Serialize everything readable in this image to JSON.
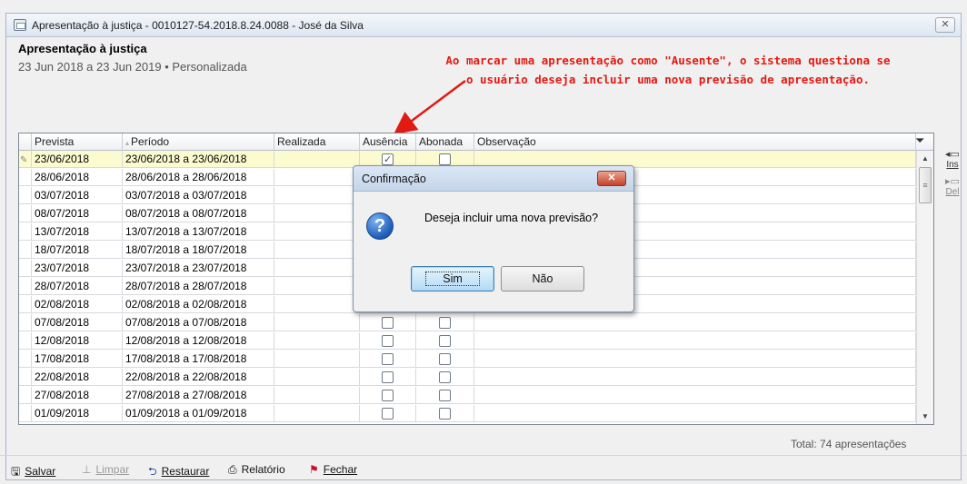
{
  "window": {
    "title": "Apresentação à justiça - 0010127-54.2018.8.24.0088 - José da Silva",
    "close_symbol": "✕"
  },
  "header": {
    "title": "Apresentação à justiça",
    "subtitle": "23 Jun 2018 a 23 Jun 2019 • Personalizada"
  },
  "annotation": {
    "line1": "Ao marcar uma apresentação como \"Ausente\", o sistema questiona se",
    "line2": "o usuário deseja incluir uma nova previsão de apresentação.",
    "color": "#e21a12"
  },
  "grid": {
    "columns": [
      "Prevista",
      "Período",
      "Realizada",
      "Ausência",
      "Abonada",
      "Observação"
    ],
    "rows": [
      {
        "prevista": "23/06/2018",
        "periodo": "23/06/2018 a 23/06/2018",
        "realizada": "",
        "ausencia": true,
        "abonada": false,
        "observacao": ""
      },
      {
        "prevista": "28/06/2018",
        "periodo": "28/06/2018 a 28/06/2018",
        "realizada": "",
        "ausencia": false,
        "abonada": false,
        "observacao": ""
      },
      {
        "prevista": "03/07/2018",
        "periodo": "03/07/2018 a 03/07/2018",
        "realizada": "",
        "ausencia": false,
        "abonada": false,
        "observacao": ""
      },
      {
        "prevista": "08/07/2018",
        "periodo": "08/07/2018 a 08/07/2018",
        "realizada": "",
        "ausencia": false,
        "abonada": false,
        "observacao": ""
      },
      {
        "prevista": "13/07/2018",
        "periodo": "13/07/2018 a 13/07/2018",
        "realizada": "",
        "ausencia": false,
        "abonada": false,
        "observacao": ""
      },
      {
        "prevista": "18/07/2018",
        "periodo": "18/07/2018 a 18/07/2018",
        "realizada": "",
        "ausencia": false,
        "abonada": false,
        "observacao": ""
      },
      {
        "prevista": "23/07/2018",
        "periodo": "23/07/2018 a 23/07/2018",
        "realizada": "",
        "ausencia": false,
        "abonada": false,
        "observacao": ""
      },
      {
        "prevista": "28/07/2018",
        "periodo": "28/07/2018 a 28/07/2018",
        "realizada": "",
        "ausencia": false,
        "abonada": false,
        "observacao": ""
      },
      {
        "prevista": "02/08/2018",
        "periodo": "02/08/2018 a 02/08/2018",
        "realizada": "",
        "ausencia": false,
        "abonada": false,
        "observacao": ""
      },
      {
        "prevista": "07/08/2018",
        "periodo": "07/08/2018 a 07/08/2018",
        "realizada": "",
        "ausencia": false,
        "abonada": false,
        "observacao": ""
      },
      {
        "prevista": "12/08/2018",
        "periodo": "12/08/2018 a 12/08/2018",
        "realizada": "",
        "ausencia": false,
        "abonada": false,
        "observacao": ""
      },
      {
        "prevista": "17/08/2018",
        "periodo": "17/08/2018 a 17/08/2018",
        "realizada": "",
        "ausencia": false,
        "abonada": false,
        "observacao": ""
      },
      {
        "prevista": "22/08/2018",
        "periodo": "22/08/2018 a 22/08/2018",
        "realizada": "",
        "ausencia": false,
        "abonada": false,
        "observacao": ""
      },
      {
        "prevista": "27/08/2018",
        "periodo": "27/08/2018 a 27/08/2018",
        "realizada": "",
        "ausencia": false,
        "abonada": false,
        "observacao": ""
      },
      {
        "prevista": "01/09/2018",
        "periodo": "01/09/2018 a 01/09/2018",
        "realizada": "",
        "ausencia": false,
        "abonada": false,
        "observacao": ""
      }
    ]
  },
  "side_buttons": {
    "insert_label": "Ins",
    "delete_label": "Del"
  },
  "footer": {
    "total": "Total: 74 apresentações"
  },
  "toolbar": {
    "save": "Salvar",
    "clear": "Limpar",
    "restore": "Restaurar",
    "report": "Relatório",
    "close": "Fechar"
  },
  "dialog": {
    "title": "Confirmação",
    "message": "Deseja incluir uma nova previsão?",
    "yes_label": "Sim",
    "no_label": "Não",
    "close_symbol": "✕"
  }
}
